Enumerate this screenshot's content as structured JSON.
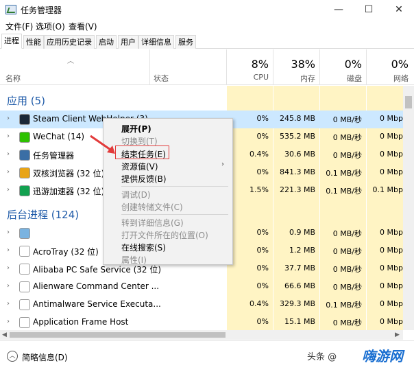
{
  "window": {
    "title": "任务管理器",
    "controls": {
      "minimize": "—",
      "maximize": "☐",
      "close": "✕"
    }
  },
  "menu": [
    "文件(F)",
    "选项(O)",
    "查看(V)"
  ],
  "tabs": [
    "进程",
    "性能",
    "应用历史记录",
    "启动",
    "用户",
    "详细信息",
    "服务"
  ],
  "active_tab": "进程",
  "columns": {
    "name": "名称",
    "status": "状态",
    "cpu": {
      "pct": "8%",
      "label": "CPU"
    },
    "memory": {
      "pct": "38%",
      "label": "内存"
    },
    "disk": {
      "pct": "0%",
      "label": "磁盘"
    },
    "network": {
      "pct": "0%",
      "label": "网络"
    }
  },
  "groups": {
    "apps": "应用 (5)",
    "background": "后台进程 (124)"
  },
  "rows": [
    {
      "name": "Steam Client WebHelper (3)",
      "cpu": "0%",
      "mem": "245.8 MB",
      "disk": "0 MB/秒",
      "net": "0 Mbp",
      "icon": "steam-icon",
      "icon_color": "#1b2838"
    },
    {
      "name": "WeChat (14)",
      "cpu": "0%",
      "mem": "535.2 MB",
      "disk": "0 MB/秒",
      "net": "0 Mbp",
      "icon": "wechat-icon",
      "icon_color": "#2dc100"
    },
    {
      "name": "任务管理器",
      "cpu": "0.4%",
      "mem": "30.6 MB",
      "disk": "0 MB/秒",
      "net": "0 Mbp",
      "icon": "task-manager-icon",
      "icon_color": "#3a6ea5"
    },
    {
      "name": "双核浏览器 (32 位) (16)",
      "cpu": "0%",
      "mem": "841.3 MB",
      "disk": "0.1 MB/秒",
      "net": "0 Mbp",
      "icon": "browser-icon",
      "icon_color": "#e8a417"
    },
    {
      "name": "迅游加速器 (32 位) (5)",
      "cpu": "1.5%",
      "mem": "221.3 MB",
      "disk": "0.1 MB/秒",
      "net": "0.1 Mbp",
      "icon": "accelerator-icon",
      "icon_color": "#12a150"
    },
    {
      "name": "",
      "cpu": "0%",
      "mem": "0.9 MB",
      "disk": "0 MB/秒",
      "net": "0 Mbp",
      "icon": "gear-icon",
      "icon_color": "#7ab3e0"
    },
    {
      "name": "AcroTray (32 位)",
      "cpu": "0%",
      "mem": "1.2 MB",
      "disk": "0 MB/秒",
      "net": "0 Mbp",
      "icon": "acrotray-icon",
      "icon_color": "#ffffff"
    },
    {
      "name": "Alibaba PC Safe Service (32 位)",
      "cpu": "0%",
      "mem": "37.7 MB",
      "disk": "0 MB/秒",
      "net": "0 Mbp",
      "icon": "alibaba-icon",
      "icon_color": "#ffffff"
    },
    {
      "name": "Alienware Command Center ...",
      "cpu": "0%",
      "mem": "66.6 MB",
      "disk": "0 MB/秒",
      "net": "0 Mbp",
      "icon": "alienware-icon",
      "icon_color": "#ffffff"
    },
    {
      "name": "Antimalware Service Executa...",
      "cpu": "0.4%",
      "mem": "329.3 MB",
      "disk": "0.1 MB/秒",
      "net": "0 Mbp",
      "icon": "antimalware-icon",
      "icon_color": "#ffffff"
    },
    {
      "name": "Application Frame Host",
      "cpu": "0%",
      "mem": "15.1 MB",
      "disk": "0 MB/秒",
      "net": "0 Mbp",
      "icon": "app-frame-icon",
      "icon_color": "#ffffff"
    }
  ],
  "context_menu": {
    "items": [
      {
        "label": "展开(P)",
        "style": "bold"
      },
      {
        "label": "切换到(T)",
        "style": "disabled"
      },
      {
        "label": "结束任务(E)",
        "style": "normal"
      },
      {
        "label": "资源值(V)",
        "style": "normal"
      },
      {
        "label": "提供反馈(B)",
        "style": "normal"
      },
      {
        "label": "调试(D)",
        "style": "disabled"
      },
      {
        "label": "创建转储文件(C)",
        "style": "disabled"
      },
      {
        "label": "转到详细信息(G)",
        "style": "disabled"
      },
      {
        "label": "打开文件所在的位置(O)",
        "style": "disabled"
      },
      {
        "label": "在线搜索(S)",
        "style": "normal"
      },
      {
        "label": "属性(I)",
        "style": "disabled"
      }
    ],
    "submenu_arrow": "›"
  },
  "footer": {
    "fewer_details": "简略信息(D)",
    "watermark": "头条 @",
    "logo": "嗨游网"
  },
  "colors": {
    "group_blue": "#1e5aa8",
    "perf_column_bg": "#fff4c4",
    "selection": "#cce8ff",
    "highlight_red": "#e23a3a"
  }
}
